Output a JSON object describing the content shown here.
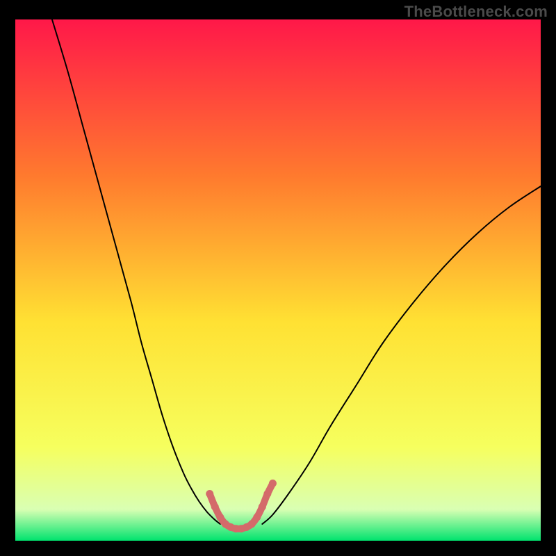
{
  "watermark": "TheBottleneck.com",
  "colors": {
    "background": "#000000",
    "gradient_top": "#ff1849",
    "gradient_mid_upper": "#ff7a2e",
    "gradient_mid": "#ffe133",
    "gradient_mid_lower": "#f6ff5e",
    "gradient_near_bottom": "#d9ffb3",
    "gradient_bottom": "#00e36e",
    "curve_stroke": "#000000",
    "accent_stroke": "#d46a6a"
  },
  "chart_data": {
    "type": "line",
    "title": "",
    "xlabel": "",
    "ylabel": "",
    "xlim": [
      0,
      100
    ],
    "ylim": [
      0,
      100
    ],
    "series": [
      {
        "name": "bottleneck-curve-left",
        "x": [
          7,
          10,
          13,
          16,
          19,
          22,
          24,
          26,
          28,
          30,
          32,
          33.5,
          35,
          36.5,
          38,
          39
        ],
        "y": [
          100,
          90,
          79,
          68,
          57,
          46,
          38,
          31,
          24,
          18,
          13,
          10,
          7.5,
          5.5,
          4,
          3.2
        ]
      },
      {
        "name": "bottleneck-curve-right",
        "x": [
          47,
          49,
          52,
          56,
          60,
          65,
          70,
          76,
          82,
          88,
          94,
          100
        ],
        "y": [
          3.2,
          5,
          9,
          15,
          22,
          30,
          38,
          46,
          53,
          59,
          64,
          68
        ]
      },
      {
        "name": "accent-valley",
        "x": [
          37,
          38,
          39,
          40,
          41,
          42,
          43,
          44,
          45,
          46,
          47,
          48,
          49
        ],
        "y": [
          9,
          6.5,
          4.5,
          3.2,
          2.6,
          2.3,
          2.3,
          2.6,
          3.2,
          4.5,
          6.5,
          9,
          11
        ]
      }
    ]
  }
}
